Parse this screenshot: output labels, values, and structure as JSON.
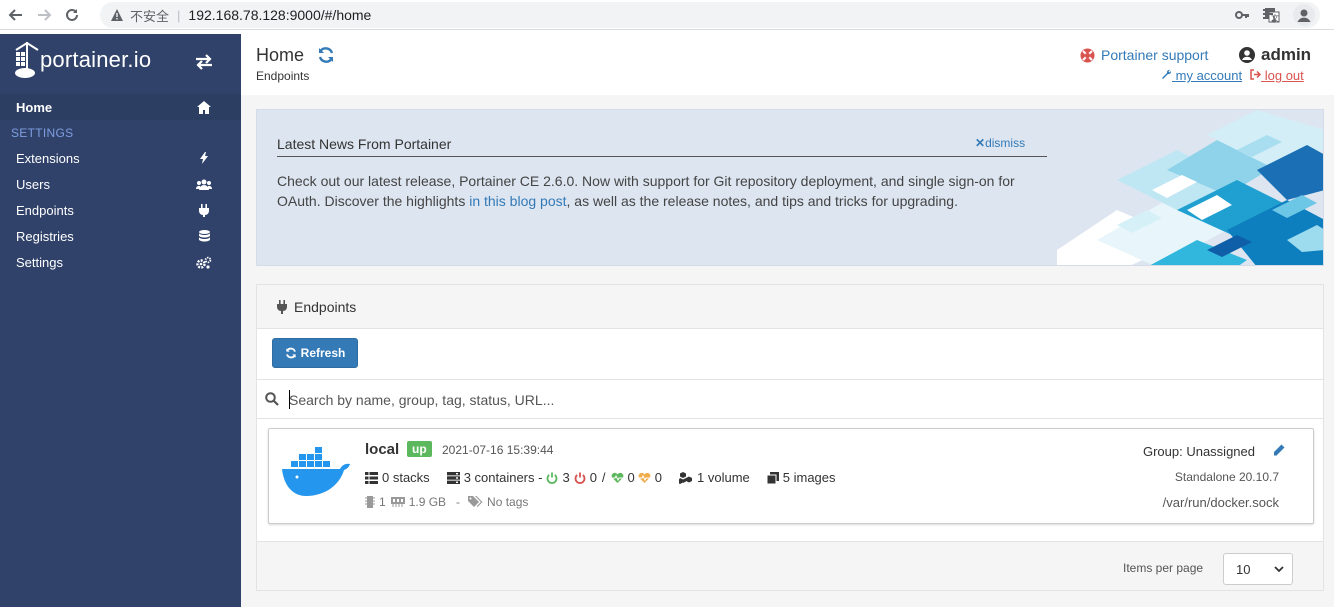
{
  "browser": {
    "security_label": "不安全",
    "url": "192.168.78.128:9000/#/home"
  },
  "sidebar": {
    "logo_text": "portainer.io",
    "home_label": "Home",
    "settings_header": "SETTINGS",
    "items": [
      {
        "label": "Extensions",
        "icon": "bolt-icon"
      },
      {
        "label": "Users",
        "icon": "users-icon"
      },
      {
        "label": "Endpoints",
        "icon": "plug-icon"
      },
      {
        "label": "Registries",
        "icon": "database-icon"
      },
      {
        "label": "Settings",
        "icon": "cogs-icon"
      }
    ]
  },
  "header": {
    "title": "Home",
    "breadcrumb": "Endpoints",
    "support_label": "Portainer support",
    "user": "admin",
    "my_account": "my account",
    "logout": "log out"
  },
  "news": {
    "title": "Latest News From Portainer",
    "dismiss": "dismiss",
    "body_before": "Check out our latest release, Portainer CE 2.6.0. Now with support for Git repository deployment, and single sign-on for OAuth. Discover the highlights ",
    "body_link": "in this blog post",
    "body_after": ", as well as the release notes, and tips and tricks for upgrading."
  },
  "endpoints": {
    "panel_title": "Endpoints",
    "refresh_label": "Refresh",
    "search_placeholder": "Search by name, group, tag, status, URL...",
    "items": [
      {
        "name": "local",
        "status": "up",
        "timestamp": "2021-07-16 15:39:44",
        "stacks": "0 stacks",
        "containers": "3 containers -",
        "running": "3",
        "stopped": "0",
        "separator": "/",
        "healthy": "0",
        "unhealthy": "0",
        "volumes": "1 volume",
        "images": "5 images",
        "cpu": "1",
        "memory": "1.9 GB",
        "dash": "-",
        "tags": "No tags",
        "group": "Group: Unassigned",
        "version": "Standalone 20.10.7",
        "url": "/var/run/docker.sock"
      }
    ],
    "items_per_page_label": "Items per page",
    "items_per_page": "10"
  },
  "colors": {
    "sidebar_bg": "#30426a",
    "primary": "#337ab7",
    "success": "#5cb85c",
    "danger": "#d9534f"
  }
}
